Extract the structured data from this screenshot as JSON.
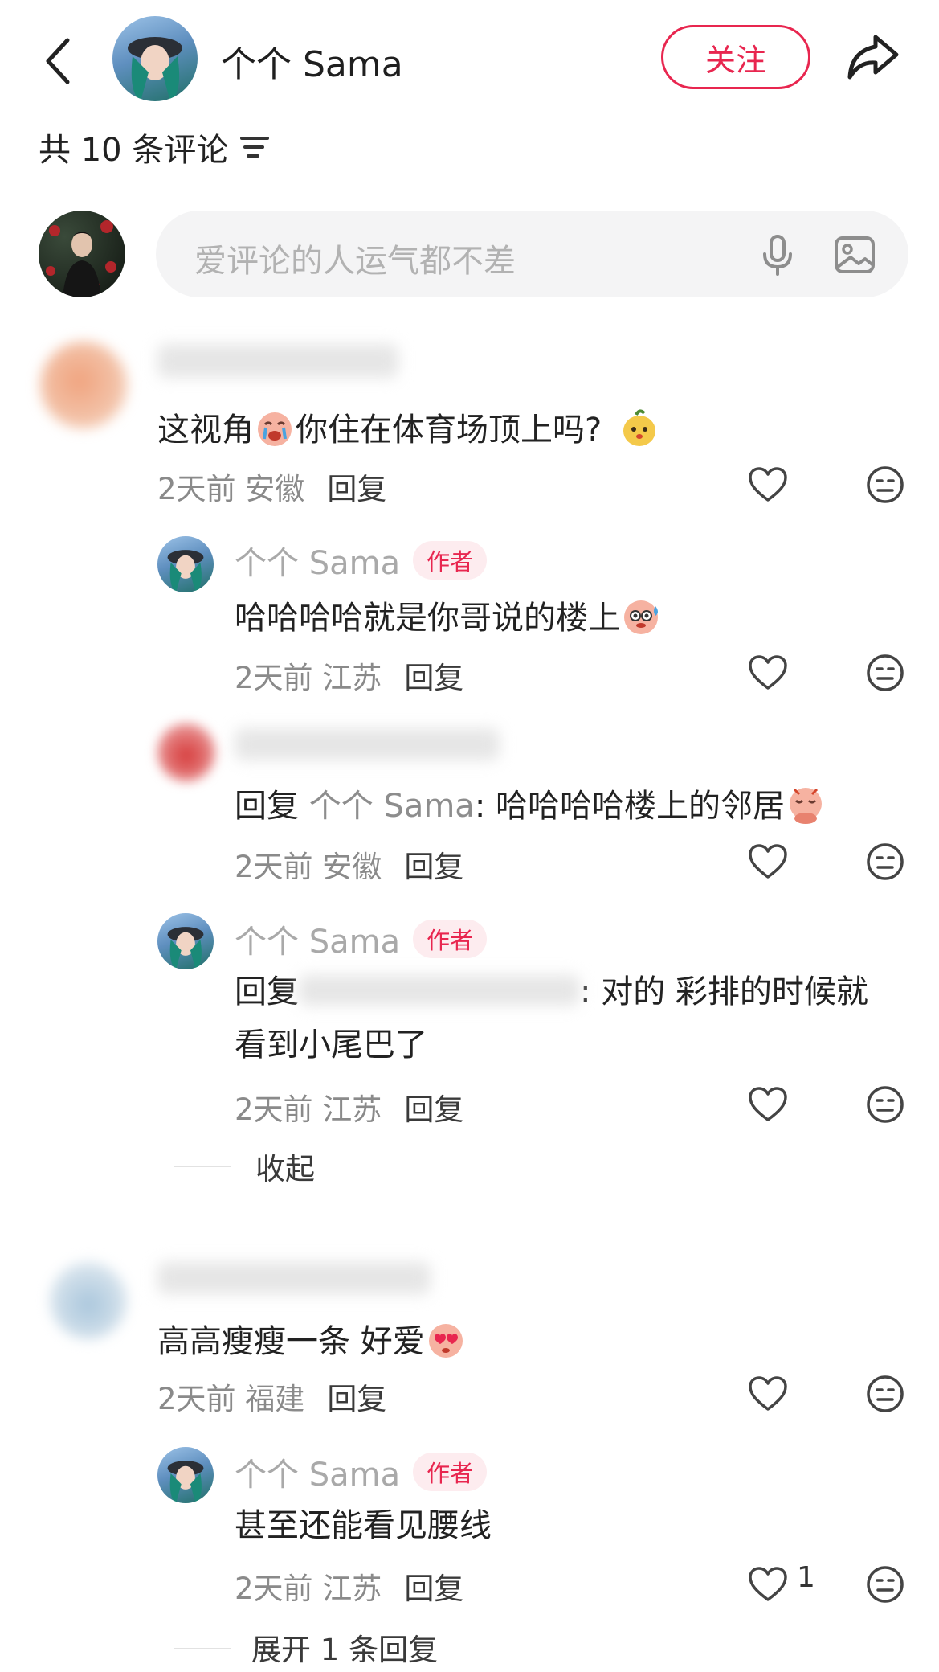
{
  "header": {
    "username": "个个 Sama",
    "follow_label": "关注"
  },
  "comments_header": {
    "count_label": "共 10 条评论"
  },
  "composer": {
    "placeholder": "爱评论的人运气都不差"
  },
  "comments": [
    {
      "text": "这视角",
      "text_after_emoji": "你住在体育场顶上吗?",
      "meta": "2天前 安徽",
      "reply_label": "回复",
      "replies": [
        {
          "author": "个个 Sama",
          "badge": "作者",
          "text": "哈哈哈哈就是你哥说的楼上",
          "meta": "2天前 江苏",
          "reply_label": "回复"
        },
        {
          "prefix": "回复",
          "mention": "个个 Sama",
          "text": ": 哈哈哈哈楼上的邻居",
          "meta": "2天前 安徽",
          "reply_label": "回复"
        },
        {
          "author": "个个 Sama",
          "badge": "作者",
          "prefix": "回复",
          "text": ": 对的 彩排的时候就",
          "text_line2": "看到小尾巴了",
          "meta": "2天前 江苏",
          "reply_label": "回复"
        }
      ],
      "collapse_label": "收起"
    },
    {
      "text": "高高瘦瘦一条 好爱",
      "meta": "2天前 福建",
      "reply_label": "回复",
      "replies": [
        {
          "author": "个个 Sama",
          "badge": "作者",
          "text": "甚至还能看见腰线",
          "meta": "2天前 江苏",
          "reply_label": "回复",
          "like_count": "1"
        }
      ],
      "expand_label": "展开 1 条回复"
    }
  ],
  "colors": {
    "accent": "#e8264f",
    "badge_bg": "#fdecef",
    "input_bg": "#f4f4f5"
  },
  "icons": [
    "back-icon",
    "share-icon",
    "sort-icon",
    "microphone-icon",
    "image-icon",
    "heart-icon",
    "emoji-face-icon"
  ]
}
